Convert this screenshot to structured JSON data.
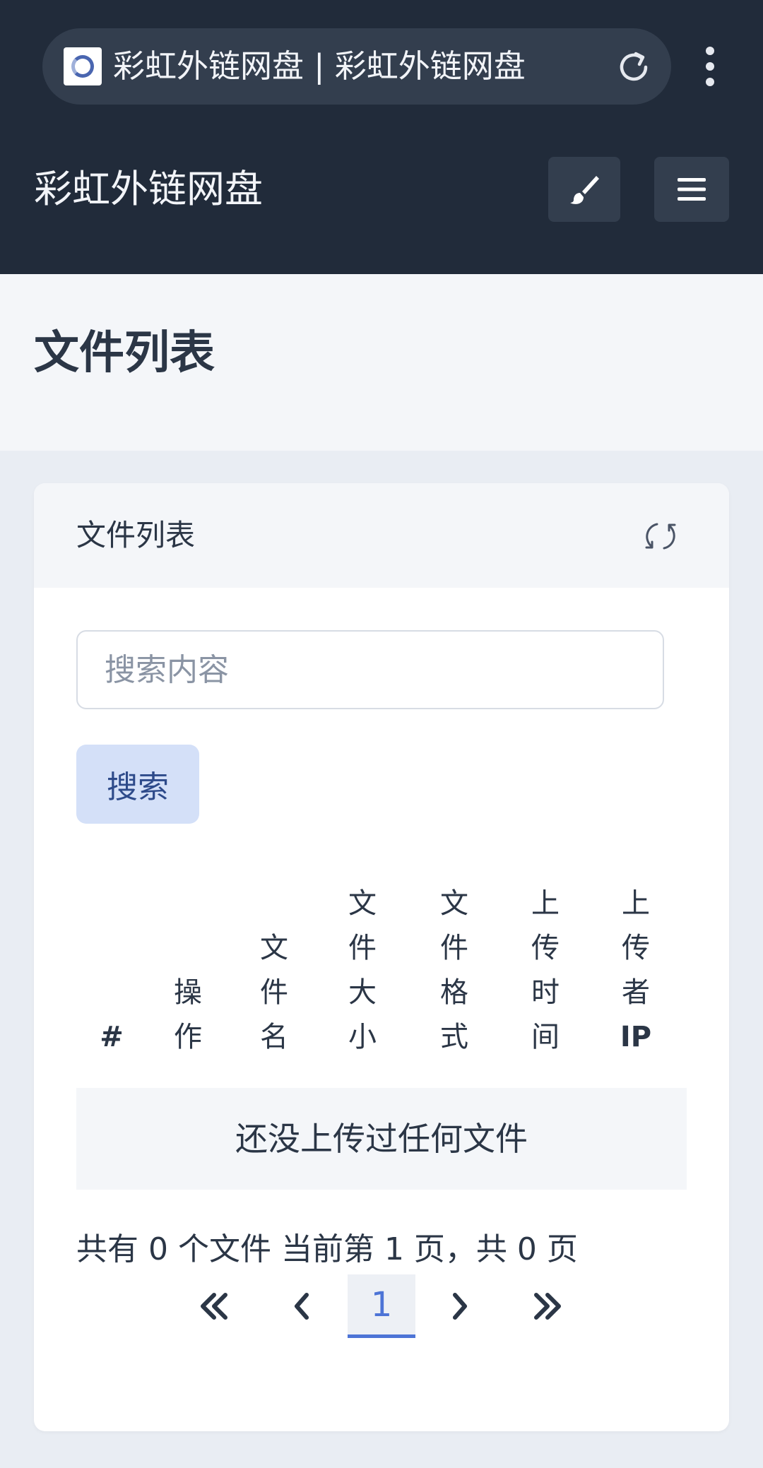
{
  "browser": {
    "tab_title": "彩虹外链网盘 | 彩虹外链网盘",
    "favicon": "rainbow-ring-icon",
    "reload_icon": "reload-icon",
    "menu_icon": "vertical-dots-icon"
  },
  "header": {
    "site_title": "彩虹外链网盘",
    "theme_button_icon": "paintbrush-icon",
    "nav_button_icon": "hamburger-menu-icon"
  },
  "page": {
    "title": "文件列表"
  },
  "card": {
    "title": "文件列表",
    "refresh_icon": "refresh-icon",
    "search": {
      "placeholder": "搜索内容",
      "value": "",
      "button_label": "搜索"
    },
    "table": {
      "columns": [
        "#",
        "操作",
        "文件名",
        "文件大小",
        "文件格式",
        "上传时间",
        "上传者IP"
      ],
      "empty_message": "还没上传过任何文件"
    },
    "summary": "共有 0 个文件  当前第 1 页，共 0 页",
    "pagination": {
      "first": "«",
      "prev": "‹",
      "current": "1",
      "next": "›",
      "last": "»"
    }
  },
  "colors": {
    "header_bg": "#212b3a",
    "accent": "#4d74d6",
    "search_button_bg": "#d4e0f8"
  }
}
